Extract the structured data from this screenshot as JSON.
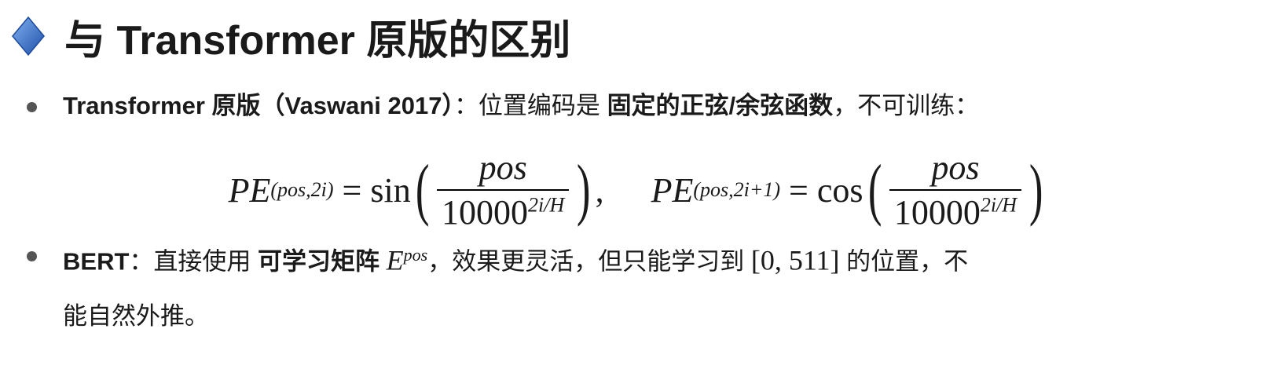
{
  "title": {
    "icon": "blue-diamond-icon",
    "text": "与 Transformer 原版的区别"
  },
  "bullet1": {
    "bold_lead": "Transformer 原版（Vaswani 2017）",
    "sep": "：位置编码是 ",
    "bold_mid": "固定的正弦/余弦函数",
    "tail": "，不可训练："
  },
  "formula": {
    "lhs1": "PE",
    "sub1": "(pos,2i)",
    "eq": "=",
    "fn1": "sin",
    "num": "pos",
    "den": "10000",
    "den_exp": "2i/H",
    "comma": ",",
    "lhs2": "PE",
    "sub2": "(pos,2i+1)",
    "fn2": "cos"
  },
  "bullet2": {
    "bold_lead": "BERT",
    "sep": "：直接使用 ",
    "bold_mid": "可学习矩阵 ",
    "mat": "E",
    "mat_sup": "pos",
    "tail1": "，效果更灵活，但只能学习到 ",
    "range": "[0, 511]",
    "tail2": " 的位置，不",
    "line2": "能自然外推。"
  }
}
